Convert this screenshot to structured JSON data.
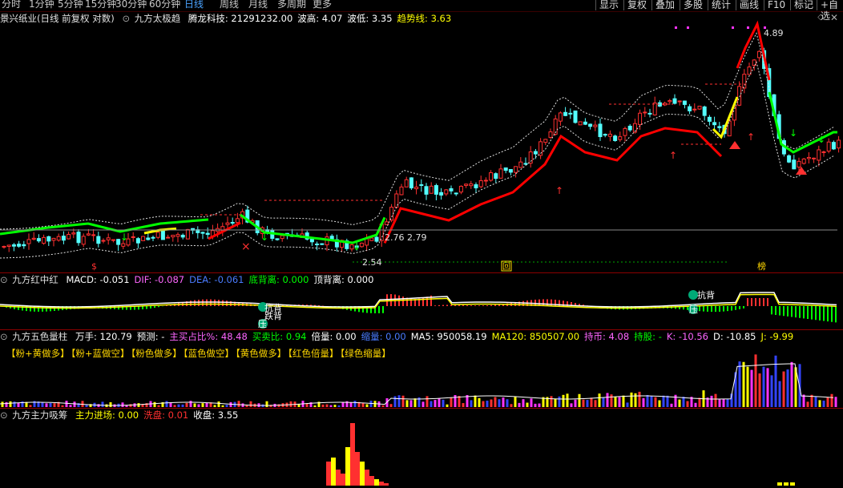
{
  "toolbar": {
    "periods": [
      "分时",
      "1分钟",
      "5分钟",
      "15分钟",
      "30分钟",
      "60分钟",
      "日线",
      "周线",
      "月线",
      "多周期",
      "更多"
    ],
    "active_period": "日线",
    "buttons": [
      "显示",
      "复权",
      "叠加",
      "多股",
      "统计",
      "画线",
      "F10",
      "标记",
      "+自选"
    ]
  },
  "main_panel": {
    "stock_title": "景兴纸业(日线 前复权 对数)",
    "indicator": "九方太极趋",
    "items": [
      {
        "label": "腾龙科技:",
        "value": "21291232.00",
        "color": "#ffffff"
      },
      {
        "label": "波高:",
        "value": "4.07",
        "color": "#ffffff"
      },
      {
        "label": "波低:",
        "value": "3.35",
        "color": "#ffffff"
      },
      {
        "label": "趋势线:",
        "value": "3.63",
        "color": "#ffff00"
      }
    ],
    "annotations": {
      "high": "4.89",
      "low": "2.54",
      "mid1": "2.76",
      "mid2": "2.79",
      "mark1": "回",
      "mark2": "榜",
      "mark3": "$"
    }
  },
  "macd_panel": {
    "title": "九方红中红",
    "items": [
      {
        "label": "MACD:",
        "value": "-0.051",
        "color": "#ffffff"
      },
      {
        "label": "DIF:",
        "value": "-0.087",
        "color": "#ff66ff"
      },
      {
        "label": "DEA:",
        "value": "-0.061",
        "color": "#4a7bff"
      },
      {
        "label": "底背离:",
        "value": "0.000",
        "color": "#00ff00"
      },
      {
        "label": "顶背离:",
        "value": "0.000",
        "color": "#ffffff"
      }
    ],
    "marks": [
      "抗背",
      "跌背",
      "压",
      "压"
    ]
  },
  "volume_panel": {
    "title": "九方五色量柱",
    "items": [
      {
        "label": "万手:",
        "value": "120.79",
        "color": "#ffffff"
      },
      {
        "label": "预测:",
        "value": "-",
        "color": "#ffffff"
      },
      {
        "label": "主买占比%:",
        "value": "48.48",
        "color": "#ff66ff"
      },
      {
        "label": "买卖比:",
        "value": "0.94",
        "color": "#00ff00"
      },
      {
        "label": "倍量:",
        "value": "0.00",
        "color": "#ffffff"
      },
      {
        "label": "缩量:",
        "value": "0.00",
        "color": "#4a7bff"
      },
      {
        "label": "MA5:",
        "value": "950058.19",
        "color": "#ffffff"
      },
      {
        "label": "MA120:",
        "value": "850507.00",
        "color": "#ffff00"
      },
      {
        "label": "持币:",
        "value": "4.08",
        "color": "#ff66ff"
      },
      {
        "label": "持股:",
        "value": "-",
        "color": "#00ff00"
      },
      {
        "label": "K:",
        "value": "-10.56",
        "color": "#ff66ff"
      },
      {
        "label": "D:",
        "value": "-10.85",
        "color": "#ffffff"
      },
      {
        "label": "J:",
        "value": "-9.99",
        "color": "#ffff00"
      }
    ],
    "legend": [
      "【粉+黄做多】",
      "【粉+蓝做空】",
      "【粉色做多】",
      "【蓝色做空】",
      "【黄色做多】",
      "【红色倍量】",
      "【绿色缩量】"
    ]
  },
  "capital_panel": {
    "title": "九方主力吸筹",
    "items": [
      {
        "label": "主力进场:",
        "value": "0.00",
        "color": "#ffff00"
      },
      {
        "label": "洗盘:",
        "value": "0.01",
        "color": "#ff3030"
      },
      {
        "label": "收盘:",
        "value": "3.55",
        "color": "#ffffff"
      }
    ]
  },
  "colors": {
    "up": "#ff3030",
    "down": "#54ffff",
    "trend_green": "#00ff00",
    "trend_red": "#ff0000",
    "trend_yellow": "#ffff00",
    "separator": "#8b0000"
  }
}
